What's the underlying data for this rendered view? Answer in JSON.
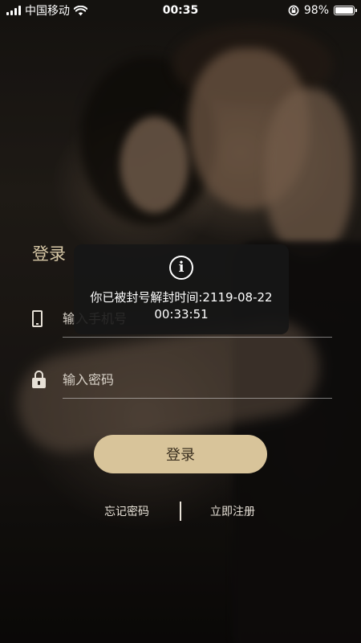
{
  "status_bar": {
    "carrier": "中国移动",
    "time": "00:35",
    "battery_percent": "98%",
    "battery_level": 0.98,
    "icons": [
      "signal-icon",
      "wifi-icon",
      "rotation-lock-icon",
      "battery-icon"
    ]
  },
  "login": {
    "title": "登录",
    "phone_field": {
      "placeholder": "输入手机号",
      "value": "",
      "icon": "phone-icon"
    },
    "password_field": {
      "placeholder": "输入密码",
      "value": "",
      "icon": "lock-icon"
    },
    "submit_label": "登录",
    "forgot_label": "忘记密码",
    "register_label": "立即注册"
  },
  "toast": {
    "icon": "info-icon",
    "message": "你已被封号解封时间:2119-08-22 00:33:51"
  },
  "colors": {
    "accent": "#d8c49a",
    "title": "#d7c8a6",
    "toast_bg": "#161616"
  }
}
